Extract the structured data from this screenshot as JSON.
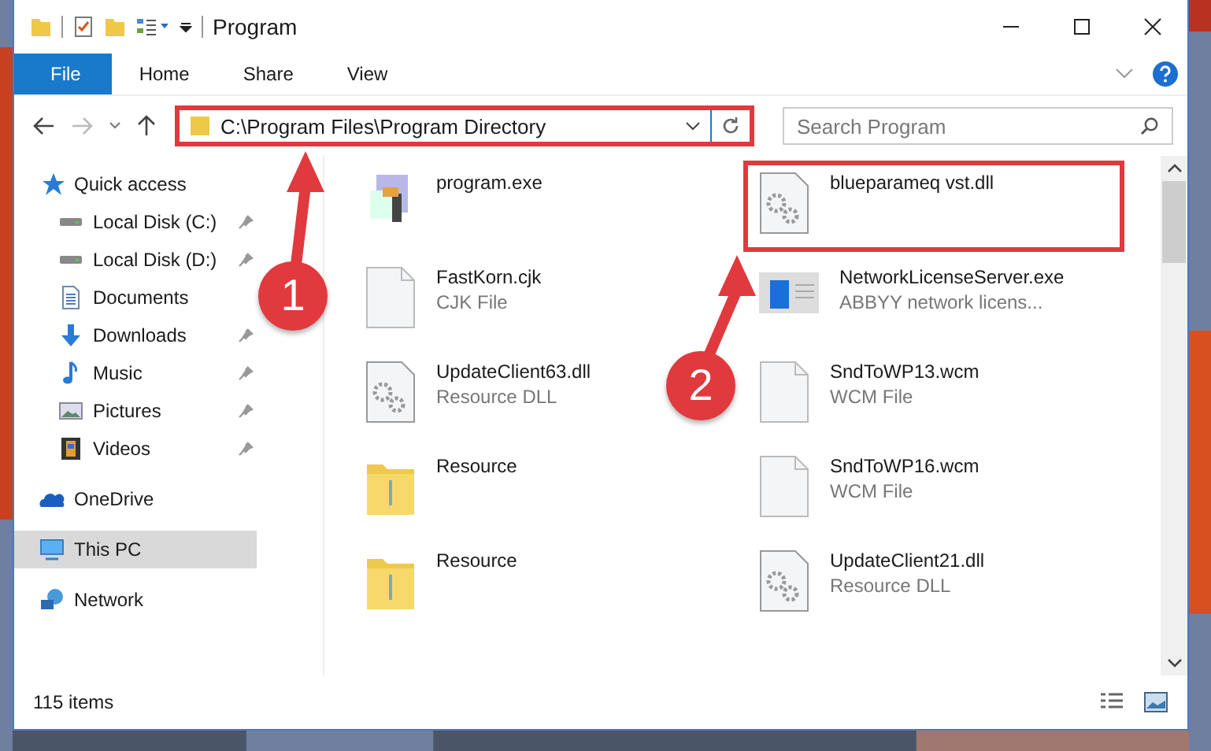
{
  "window": {
    "title": "Program"
  },
  "ribbon_tabs": [
    {
      "label": "File",
      "kind": "file"
    },
    {
      "label": "Home",
      "kind": "tab"
    },
    {
      "label": "Share",
      "kind": "tab"
    },
    {
      "label": "View",
      "kind": "tab"
    }
  ],
  "address": {
    "path": "C:\\Program Files\\Program Directory",
    "highlighted": true
  },
  "search": {
    "placeholder": "Search Program"
  },
  "sidebar": {
    "items": [
      {
        "label": "Quick access",
        "kind": "star",
        "selected": false,
        "pinned": false,
        "children": [
          {
            "label": "Local Disk (C:)",
            "kind": "drive",
            "selected": false,
            "pinned": true
          },
          {
            "label": "Local Disk (D:)",
            "kind": "drive",
            "selected": false,
            "pinned": true
          },
          {
            "label": "Documents",
            "kind": "document",
            "selected": false,
            "pinned": false
          },
          {
            "label": "Downloads",
            "kind": "download",
            "selected": false,
            "pinned": true
          },
          {
            "label": "Music",
            "kind": "music",
            "selected": false,
            "pinned": true
          },
          {
            "label": "Pictures",
            "kind": "pictures",
            "selected": false,
            "pinned": true
          },
          {
            "label": "Videos",
            "kind": "videos",
            "selected": false,
            "pinned": true
          }
        ]
      },
      {
        "label": "OneDrive",
        "kind": "cloud",
        "selected": false,
        "pinned": false
      },
      {
        "label": "This PC",
        "kind": "pc",
        "selected": true,
        "pinned": false
      },
      {
        "label": "Network",
        "kind": "network",
        "selected": false,
        "pinned": false
      }
    ]
  },
  "files": [
    {
      "name": "program.exe",
      "kind": "program",
      "highlighted": false
    },
    {
      "name": "blueparameq vst.dll",
      "kind": "dll",
      "highlighted": true
    },
    {
      "name": "FastKorn.cjk",
      "type": "CJK File",
      "kind": "blank",
      "highlighted": false
    },
    {
      "name": "NetworkLicenseServer.exe",
      "type": "ABBYY network licens...",
      "kind": "app",
      "highlighted": false
    },
    {
      "name": "UpdateClient63.dll",
      "type": "Resource DLL",
      "kind": "dll",
      "highlighted": false
    },
    {
      "name": "SndToWP13.wcm",
      "type": "WCM File",
      "kind": "blank",
      "highlighted": false
    },
    {
      "name": "Resource",
      "kind": "folder",
      "highlighted": false
    },
    {
      "name": "SndToWP16.wcm",
      "type": "WCM File",
      "kind": "blank",
      "highlighted": false
    },
    {
      "name": "Resource",
      "kind": "folder",
      "highlighted": false
    },
    {
      "name": "UpdateClient21.dll",
      "type": "Resource DLL",
      "kind": "dll",
      "highlighted": false
    }
  ],
  "annotations": [
    {
      "number": "1"
    },
    {
      "number": "2"
    }
  ],
  "status_bar": {
    "count": "115 items"
  }
}
